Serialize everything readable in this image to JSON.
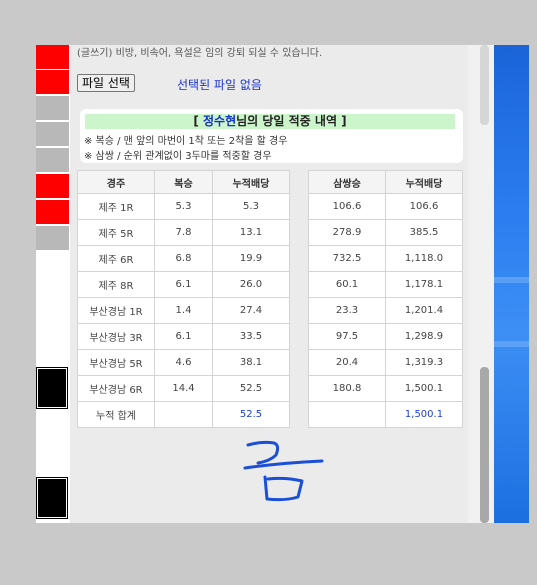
{
  "notice_text": "(글쓰기) 비방, 비속어, 욕설은 임의 강퇴 되실 수 있습니다.",
  "file": {
    "button_label": "파일 선택",
    "status": "선택된 파일 없음"
  },
  "summary": {
    "title_open": "[ ",
    "name": "정수현",
    "title_rest": "님의 당일 적중 내역 ]",
    "note1": "※ 복승 / 맨 앞의 마번이 1착 또는 2착을 할 경우",
    "note2": "※ 삼쌍 / 순위 관계없이 3두마를 적중할 경우"
  },
  "table_left": {
    "headers": [
      "경주",
      "복승",
      "누적배당"
    ],
    "rows": [
      [
        "제주 1R",
        "5.3",
        "5.3"
      ],
      [
        "제주 5R",
        "7.8",
        "13.1"
      ],
      [
        "제주 6R",
        "6.8",
        "19.9"
      ],
      [
        "제주 8R",
        "6.1",
        "26.0"
      ],
      [
        "부산경남 1R",
        "1.4",
        "27.4"
      ],
      [
        "부산경남 3R",
        "6.1",
        "33.5"
      ],
      [
        "부산경남 5R",
        "4.6",
        "38.1"
      ],
      [
        "부산경남 6R",
        "14.4",
        "52.5"
      ]
    ],
    "total": [
      "누적 합계",
      "",
      "52.5"
    ]
  },
  "table_right": {
    "headers": [
      "삼쌍승",
      "누적배당"
    ],
    "rows": [
      [
        "106.6",
        "106.6"
      ],
      [
        "278.9",
        "385.5"
      ],
      [
        "732.5",
        "1,118.0"
      ],
      [
        "60.1",
        "1,178.1"
      ],
      [
        "23.3",
        "1,201.4"
      ],
      [
        "97.5",
        "1,298.9"
      ],
      [
        "20.4",
        "1,319.3"
      ],
      [
        "180.8",
        "1,500.1"
      ]
    ],
    "total": [
      "",
      "1,500.1"
    ]
  },
  "colors": {
    "accent_blue": "#1d3fd0",
    "title_bg": "#ccf5cc",
    "left_red": "#ff0000",
    "handwriting": "#1a4fd6"
  },
  "handwriting_icon": "handwritten-korean-glyph"
}
